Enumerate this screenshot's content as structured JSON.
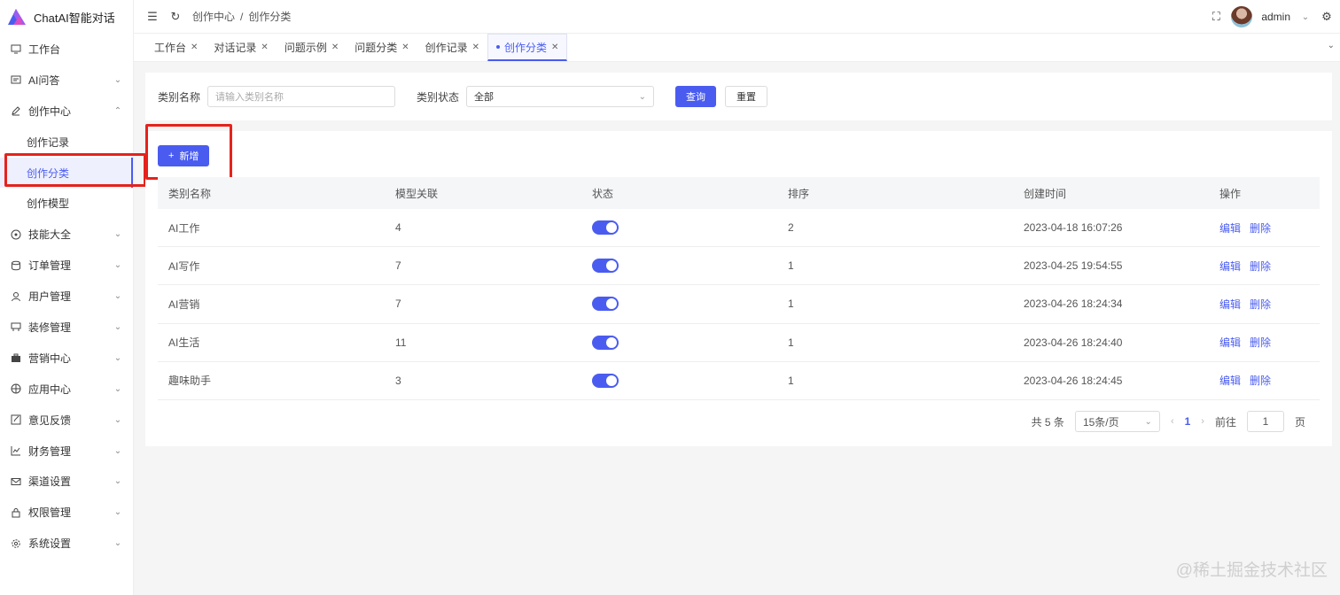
{
  "brand": {
    "name": "ChatAI智能对话"
  },
  "sidebar": {
    "items": [
      {
        "label": "工作台",
        "icon": "monitor-icon"
      },
      {
        "label": "AI问答",
        "icon": "message-icon"
      },
      {
        "label": "创作中心",
        "icon": "edit-icon"
      },
      {
        "label": "创作记录"
      },
      {
        "label": "创作分类"
      },
      {
        "label": "创作模型"
      },
      {
        "label": "技能大全",
        "icon": "compass-icon"
      },
      {
        "label": "订单管理",
        "icon": "database-icon"
      },
      {
        "label": "用户管理",
        "icon": "user-icon"
      },
      {
        "label": "装修管理",
        "icon": "decor-icon"
      },
      {
        "label": "营销中心",
        "icon": "briefcase-icon"
      },
      {
        "label": "应用中心",
        "icon": "app-icon"
      },
      {
        "label": "意见反馈",
        "icon": "feedback-icon"
      },
      {
        "label": "财务管理",
        "icon": "chart-icon"
      },
      {
        "label": "渠道设置",
        "icon": "mail-icon"
      },
      {
        "label": "权限管理",
        "icon": "lock-icon"
      },
      {
        "label": "系统设置",
        "icon": "gear-icon"
      }
    ]
  },
  "header": {
    "breadcrumb": [
      "创作中心",
      "/",
      "创作分类"
    ],
    "user": "admin"
  },
  "tabs": [
    "工作台",
    "对话记录",
    "问题示例",
    "问题分类",
    "创作记录",
    "创作分类"
  ],
  "search": {
    "name_label": "类别名称",
    "name_placeholder": "请输入类别名称",
    "status_label": "类别状态",
    "status_value": "全部",
    "query": "查询",
    "reset": "重置"
  },
  "toolbar": {
    "add": "新增"
  },
  "table": {
    "headers": [
      "类别名称",
      "模型关联",
      "状态",
      "排序",
      "创建时间",
      "操作"
    ],
    "rows": [
      {
        "name": "AI工作",
        "models": "4",
        "sort": "2",
        "created": "2023-04-18 16:07:26"
      },
      {
        "name": "AI写作",
        "models": "7",
        "sort": "1",
        "created": "2023-04-25 19:54:55"
      },
      {
        "name": "AI营销",
        "models": "7",
        "sort": "1",
        "created": "2023-04-26 18:24:34"
      },
      {
        "name": "AI生活",
        "models": "11",
        "sort": "1",
        "created": "2023-04-26 18:24:40"
      },
      {
        "name": "趣味助手",
        "models": "3",
        "sort": "1",
        "created": "2023-04-26 18:24:45"
      }
    ],
    "edit": "编辑",
    "delete": "删除"
  },
  "pagination": {
    "total": "共 5 条",
    "page_size": "15条/页",
    "current": "1",
    "goto_label": "前往",
    "goto_value": "1",
    "page_suffix": "页"
  },
  "watermark": "@稀土掘金技术社区",
  "colors": {
    "accent": "#4a5cf0",
    "highlight": "#e5231c"
  }
}
